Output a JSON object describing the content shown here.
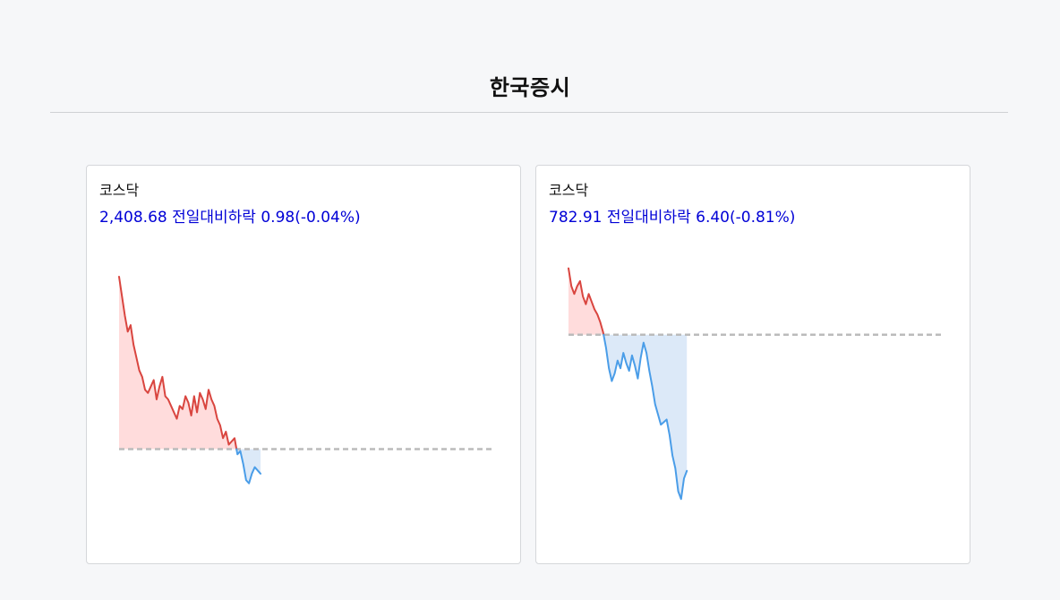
{
  "page": {
    "title": "한국증시"
  },
  "cards": [
    {
      "name": "코스닥",
      "change_text": "2,408.68 전일대비하락 0.98(-0.04%)"
    },
    {
      "name": "코스닥",
      "change_text": "782.91 전일대비하락 6.40(-0.81%)"
    }
  ],
  "colors": {
    "up_line": "#d9453f",
    "up_fill": "#ffdcdc",
    "down_line": "#4a9de8",
    "down_fill": "#dce9f8",
    "baseline": "#bbbbbb",
    "change_text": "#0000d6"
  },
  "chart_data": [
    {
      "type": "area",
      "x_count": 130,
      "baseline": 2409.66,
      "ylim": [
        2407.4,
        2415.5
      ],
      "values": [
        2415.0,
        2414.4,
        2413.8,
        2413.3,
        2413.5,
        2412.9,
        2412.5,
        2412.1,
        2411.9,
        2411.5,
        2411.4,
        2411.6,
        2411.8,
        2411.2,
        2411.6,
        2411.9,
        2411.3,
        2411.2,
        2411.0,
        2410.8,
        2410.6,
        2411.0,
        2410.9,
        2411.3,
        2411.1,
        2410.7,
        2411.3,
        2410.8,
        2411.4,
        2411.2,
        2410.9,
        2411.5,
        2411.2,
        2411.0,
        2410.6,
        2410.4,
        2410.0,
        2410.2,
        2409.8,
        2409.9,
        2410.0,
        2409.5,
        2409.6,
        2409.2,
        2408.7,
        2408.6,
        2408.9,
        2409.1,
        2409.0,
        2408.9
      ],
      "title": "",
      "xlabel": "",
      "ylabel": ""
    },
    {
      "type": "area",
      "x_count": 130,
      "baseline": 789.31,
      "ylim": [
        782.0,
        792.2
      ],
      "values": [
        791.9,
        791.2,
        790.9,
        791.2,
        791.4,
        790.8,
        790.5,
        790.9,
        790.6,
        790.3,
        790.1,
        789.8,
        789.4,
        788.8,
        788.0,
        787.5,
        787.8,
        788.3,
        788.0,
        788.6,
        788.2,
        787.9,
        788.5,
        788.1,
        787.6,
        788.4,
        789.0,
        788.6,
        787.9,
        787.3,
        786.6,
        786.2,
        785.8,
        785.9,
        786.0,
        785.4,
        784.6,
        784.1,
        783.2,
        782.9,
        783.7,
        784.0
      ],
      "title": "",
      "xlabel": "",
      "ylabel": ""
    }
  ]
}
